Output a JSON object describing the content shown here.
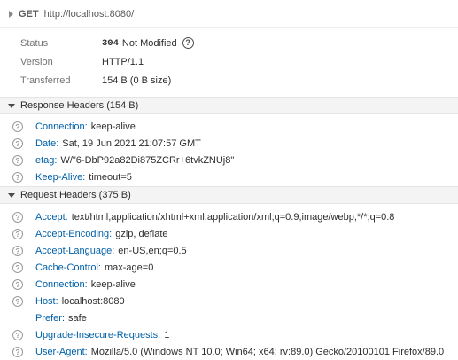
{
  "request": {
    "method": "GET",
    "url": "http://localhost:8080/"
  },
  "summary": {
    "status_label": "Status",
    "status_code": "304",
    "status_text": "Not Modified",
    "version_label": "Version",
    "version_value": "HTTP/1.1",
    "transferred_label": "Transferred",
    "transferred_value": "154 B (0 B size)"
  },
  "response_headers": {
    "title": "Response Headers (154 B)",
    "items": [
      {
        "name": "Connection:",
        "value": "keep-alive"
      },
      {
        "name": "Date:",
        "value": "Sat, 19 Jun 2021 21:07:57 GMT"
      },
      {
        "name": "etag:",
        "value": "W/\"6-DbP92a82Di875ZCRr+6tvkZNUj8\""
      },
      {
        "name": "Keep-Alive:",
        "value": "timeout=5"
      }
    ]
  },
  "request_headers": {
    "title": "Request Headers (375 B)",
    "items": [
      {
        "name": "Accept:",
        "value": "text/html,application/xhtml+xml,application/xml;q=0.9,image/webp,*/*;q=0.8"
      },
      {
        "name": "Accept-Encoding:",
        "value": "gzip, deflate"
      },
      {
        "name": "Accept-Language:",
        "value": "en-US,en;q=0.5"
      },
      {
        "name": "Cache-Control:",
        "value": "max-age=0"
      },
      {
        "name": "Connection:",
        "value": "keep-alive"
      },
      {
        "name": "Host:",
        "value": "localhost:8080"
      },
      {
        "name": "Prefer:",
        "value": "safe"
      },
      {
        "name": "Upgrade-Insecure-Requests:",
        "value": "1"
      },
      {
        "name": "User-Agent:",
        "value": "Mozilla/5.0 (Windows NT 10.0; Win64; x64; rv:89.0) Gecko/20100101 Firefox/89.0"
      }
    ]
  },
  "icons": {
    "expand": "chevron-right-icon",
    "collapse": "chevron-down-icon",
    "help": "question-circle-icon"
  },
  "colors": {
    "header_name": "#0060a8",
    "section_bg": "#f4f4f5"
  }
}
